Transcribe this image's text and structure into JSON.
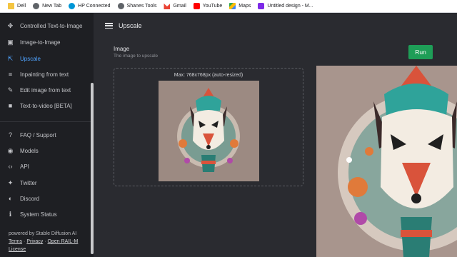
{
  "bookmarks": [
    {
      "label": "Dell",
      "icon": "folder-icon"
    },
    {
      "label": "New Tab",
      "icon": "globe-icon"
    },
    {
      "label": "HP Connected",
      "icon": "hp-icon"
    },
    {
      "label": "Shanes Tools",
      "icon": "globe-icon"
    },
    {
      "label": "Gmail",
      "icon": "gmail-icon"
    },
    {
      "label": "YouTube",
      "icon": "youtube-icon"
    },
    {
      "label": "Maps",
      "icon": "maps-icon"
    },
    {
      "label": "Untitled design - M...",
      "icon": "canva-icon"
    }
  ],
  "sidebar": {
    "items": [
      {
        "label": "Controlled Text-to-Image",
        "icon": "move-icon",
        "glyph": "✥"
      },
      {
        "label": "Image-to-Image",
        "icon": "image-icon",
        "glyph": "▣"
      },
      {
        "label": "Upscale",
        "icon": "upscale-icon",
        "glyph": "⇱",
        "active": true
      },
      {
        "label": "Inpainting from text",
        "icon": "inpaint-icon",
        "glyph": "≡"
      },
      {
        "label": "Edit image from text",
        "icon": "edit-icon",
        "glyph": "✎"
      },
      {
        "label": "Text-to-video [BETA]",
        "icon": "video-icon",
        "glyph": "■"
      },
      {
        "label": "FAQ / Support",
        "icon": "help-icon",
        "glyph": "?"
      },
      {
        "label": "Models",
        "icon": "models-icon",
        "glyph": "◉"
      },
      {
        "label": "API",
        "icon": "code-icon",
        "glyph": "‹›"
      },
      {
        "label": "Twitter",
        "icon": "twitter-icon",
        "glyph": "✦"
      },
      {
        "label": "Discord",
        "icon": "discord-icon",
        "glyph": "◐"
      },
      {
        "label": "System Status",
        "icon": "info-icon",
        "glyph": "ℹ"
      }
    ],
    "powered_by": "powered by Stable Diffusion AI",
    "links": {
      "terms": "Terms",
      "privacy": "Privacy",
      "license": "Open RAIL-M License",
      "dot": "·"
    }
  },
  "header": {
    "title": "Upscale"
  },
  "main": {
    "image_label": "Image",
    "image_sub": "The image to upscale",
    "max_label": "Max: 768x768px (auto-resized)",
    "run_label": "Run"
  },
  "colors": {
    "accent": "#4fa3ff",
    "run": "#1e9e57",
    "background": "#2a2b30",
    "sidebar": "#1e1f23"
  }
}
